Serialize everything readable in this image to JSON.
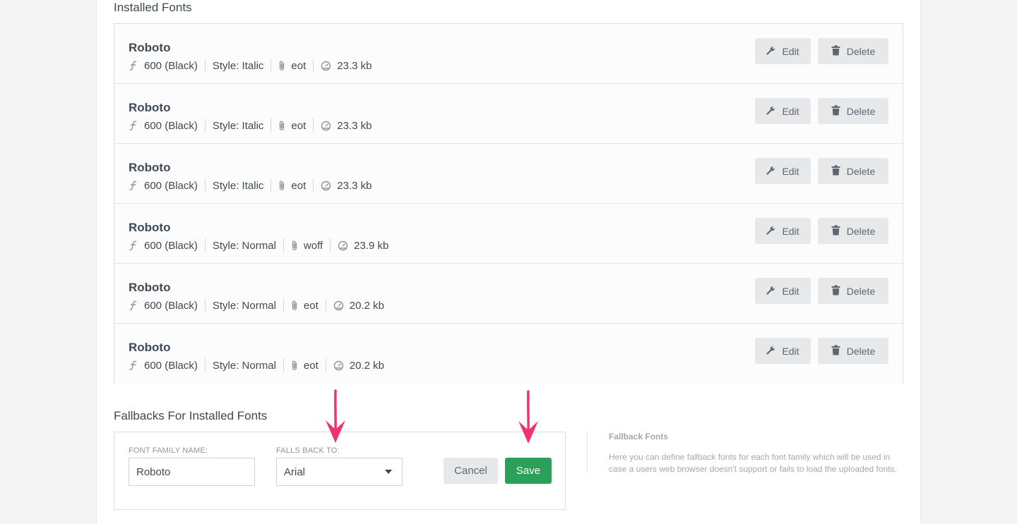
{
  "installed": {
    "title": "Installed Fonts",
    "fonts": [
      {
        "name": "Roboto",
        "weight": "600 (Black)",
        "style": "Style: Italic",
        "format": "eot",
        "size": "23.3 kb"
      },
      {
        "name": "Roboto",
        "weight": "600 (Black)",
        "style": "Style: Italic",
        "format": "eot",
        "size": "23.3 kb"
      },
      {
        "name": "Roboto",
        "weight": "600 (Black)",
        "style": "Style: Italic",
        "format": "eot",
        "size": "23.3 kb"
      },
      {
        "name": "Roboto",
        "weight": "600 (Black)",
        "style": "Style: Normal",
        "format": "woff",
        "size": "23.9 kb"
      },
      {
        "name": "Roboto",
        "weight": "600 (Black)",
        "style": "Style: Normal",
        "format": "eot",
        "size": "20.2 kb"
      },
      {
        "name": "Roboto",
        "weight": "600 (Black)",
        "style": "Style: Normal",
        "format": "eot",
        "size": "20.2 kb"
      }
    ],
    "edit_label": "Edit",
    "delete_label": "Delete"
  },
  "fallbacks": {
    "title": "Fallbacks For Installed Fonts",
    "family_label": "FONT FAMILY NAME:",
    "family_value": "Roboto",
    "fallback_label": "FALLS BACK TO:",
    "fallback_value": "Arial",
    "cancel_label": "Cancel",
    "save_label": "Save"
  },
  "help": {
    "title": "Fallback Fonts",
    "text": "Here you can define fallback fonts for each font family which will be used in case a users web browser doesn't support or fails to load the uploaded fonts."
  },
  "colors": {
    "accent_green": "#2ba05b",
    "annotation_arrow": "#f0336b"
  },
  "icons": {
    "weight": "font-icon",
    "format": "paperclip-icon",
    "size": "gauge-icon",
    "edit": "wrench-icon",
    "delete": "trash-icon"
  }
}
